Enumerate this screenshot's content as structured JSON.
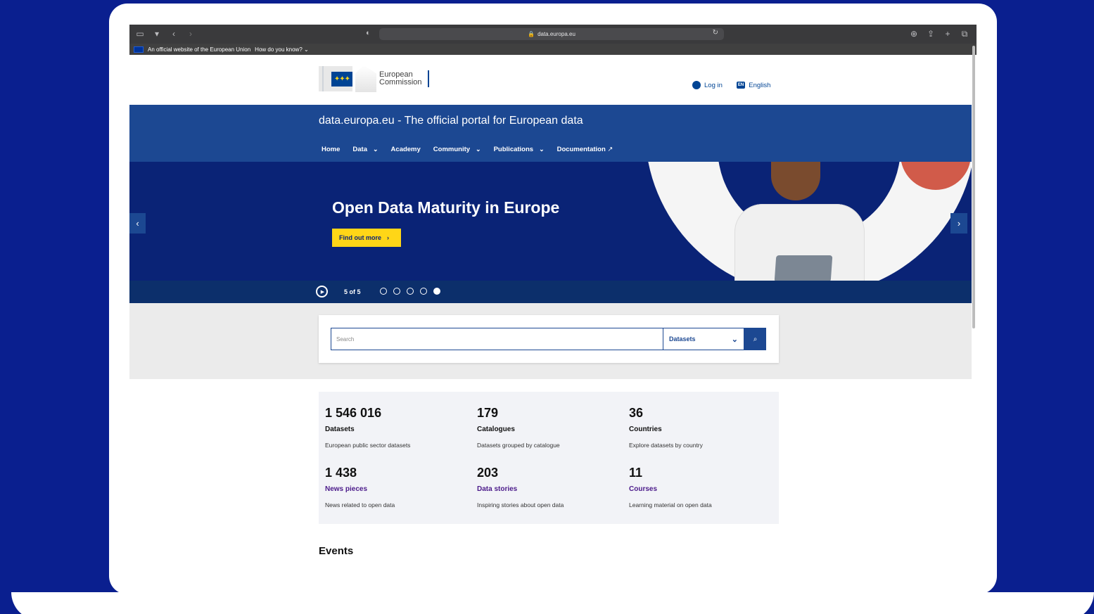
{
  "browser": {
    "url": "data.europa.eu"
  },
  "eu_banner": {
    "text": "An official website of the European Union",
    "how_link": "How do you know?"
  },
  "header": {
    "logo_line1": "European",
    "logo_line2": "Commission",
    "login": "Log in",
    "lang_code": "EN",
    "language": "English"
  },
  "site": {
    "title": "data.europa.eu - The official portal for European data"
  },
  "nav": {
    "items": [
      {
        "label": "Home"
      },
      {
        "label": "Data"
      },
      {
        "label": "Academy"
      },
      {
        "label": "Community"
      },
      {
        "label": "Publications"
      },
      {
        "label": "Documentation"
      }
    ]
  },
  "hero": {
    "title": "Open Data Maturity in Europe",
    "button": "Find out more",
    "slide_count": "5 of 5",
    "active_slide": 5,
    "total_slides": 5
  },
  "search": {
    "placeholder": "Search",
    "scope": "Datasets"
  },
  "stats": [
    {
      "number": "1 546 016",
      "label": "Datasets",
      "desc": "European public sector datasets",
      "link": false
    },
    {
      "number": "179",
      "label": "Catalogues",
      "desc": "Datasets grouped by catalogue",
      "link": false
    },
    {
      "number": "36",
      "label": "Countries",
      "desc": "Explore datasets by country",
      "link": false
    },
    {
      "number": "1 438",
      "label": "News pieces",
      "desc": "News related to open data",
      "link": true
    },
    {
      "number": "203",
      "label": "Data stories",
      "desc": "Inspiring stories about open data",
      "link": true
    },
    {
      "number": "11",
      "label": "Courses",
      "desc": "Learning material on open data",
      "link": true
    }
  ],
  "events": {
    "heading": "Events"
  },
  "colors": {
    "background": "#0a1f8f",
    "site_blue": "#1c4892",
    "hero_navy": "#0a2376",
    "cta_yellow": "#ffd617",
    "link_purple": "#4b1a8a"
  }
}
